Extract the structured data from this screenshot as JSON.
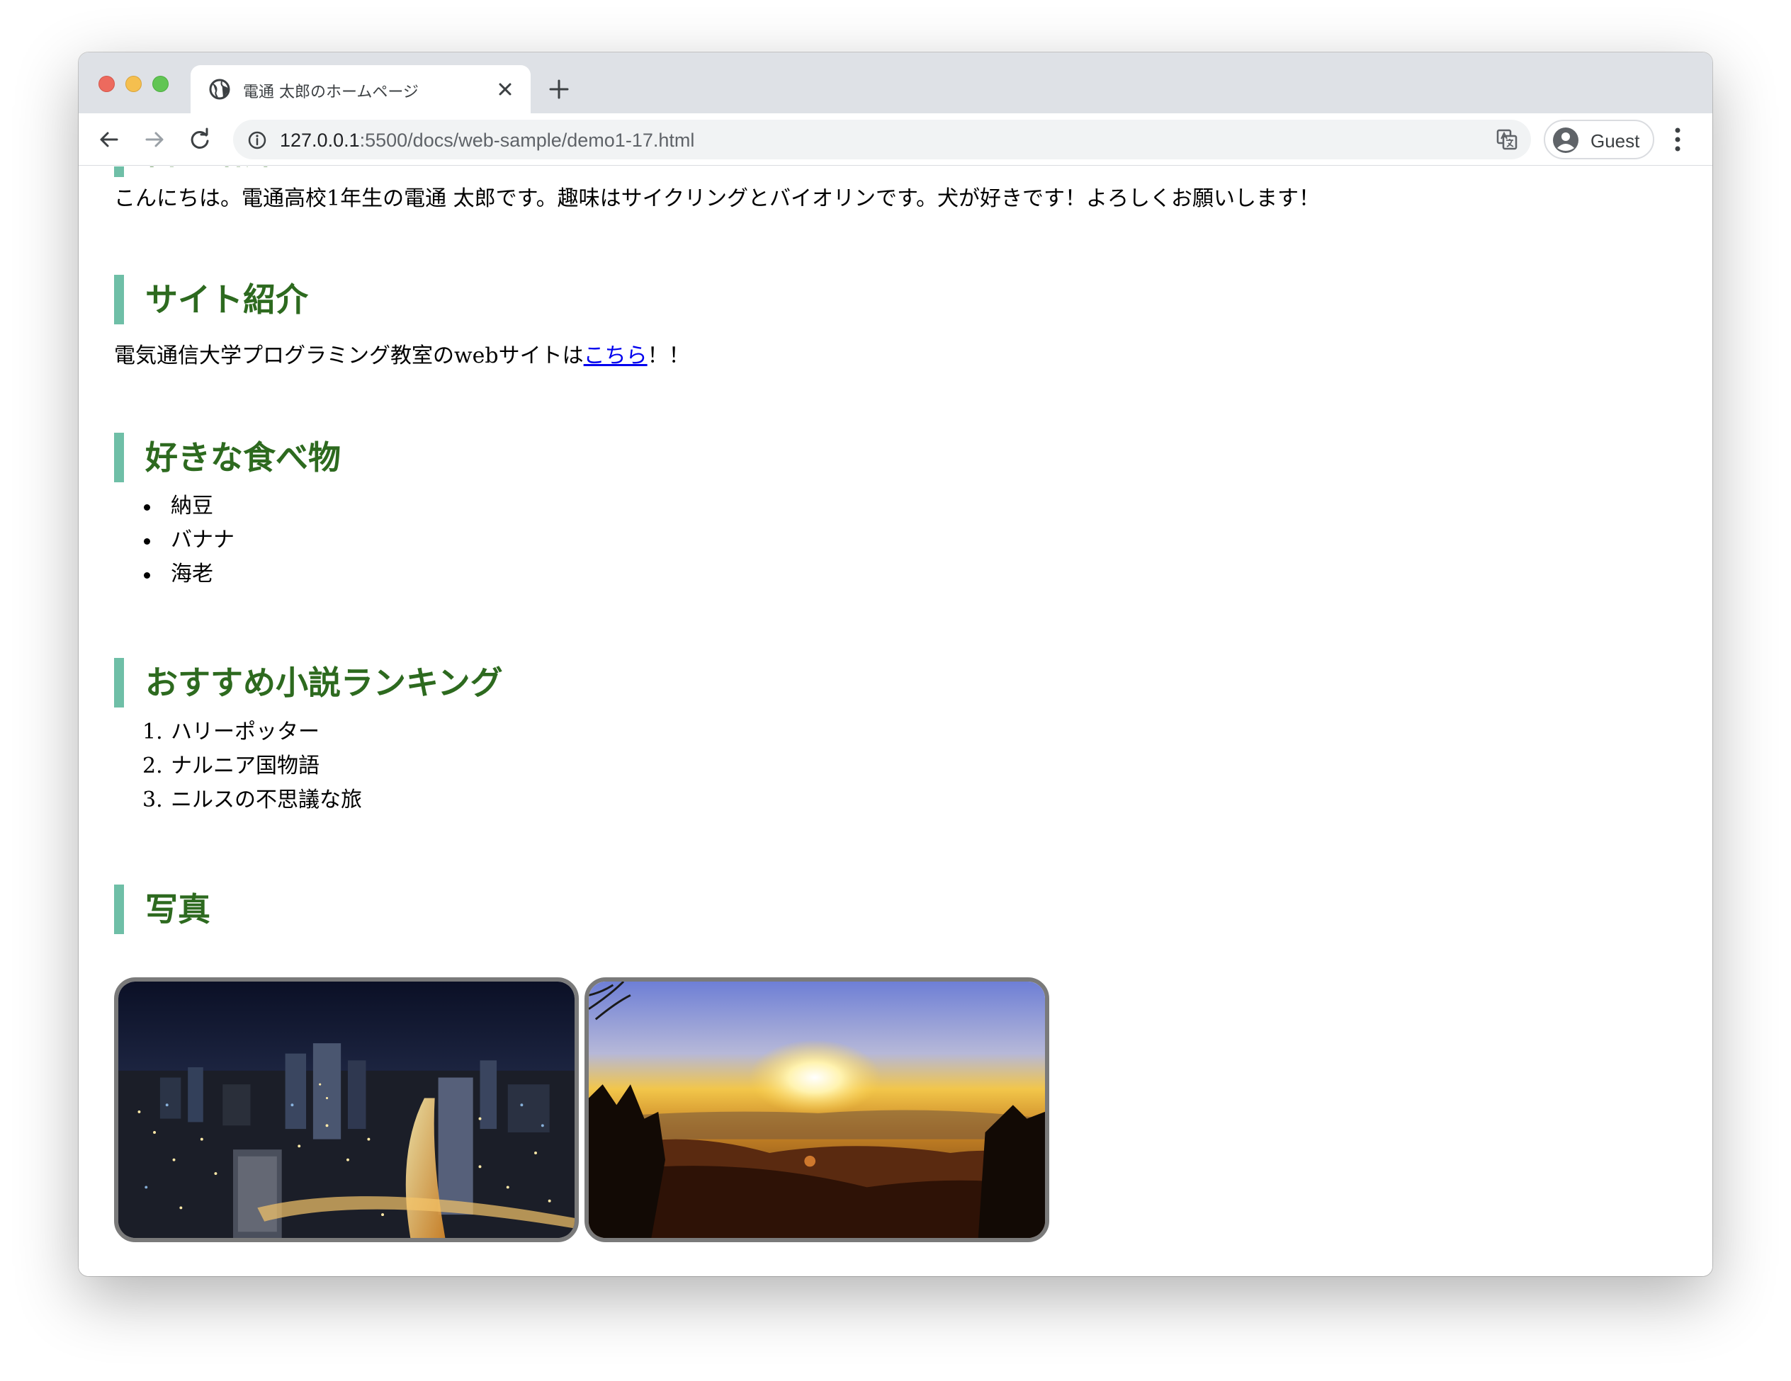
{
  "browser": {
    "tab_title": "電通 太郎のホームページ",
    "url_host": "127.0.0.1",
    "url_rest": ":5500/docs/web-sample/demo1-17.html",
    "profile_label": "Guest",
    "icons": [
      "globe-icon",
      "close-icon",
      "plus-icon",
      "back-arrow-icon",
      "forward-arrow-icon",
      "reload-icon",
      "info-icon",
      "translate-icon",
      "person-avatar-icon",
      "kebab-menu-icon"
    ]
  },
  "page": {
    "intro_heading_partial": "自己紹介",
    "intro_text": "こんにちは。電通高校1年生の電通 太郎です。趣味はサイクリングとバイオリンです。犬が好きです！よろしくお願いします！",
    "site_heading": "サイト紹介",
    "site_text_before": "電気通信大学プログラミング教室のwebサイトは",
    "site_link": "こちら",
    "site_text_after": "！！",
    "food_heading": "好きな食べ物",
    "foods": [
      "納豆",
      "バナナ",
      "海老"
    ],
    "novel_heading": "おすすめ小説ランキング",
    "novels": [
      "ハリーポッター",
      "ナルニア国物語",
      "ニルスの不思議な旅"
    ],
    "photo_heading": "写真",
    "photos": [
      "city-night-photo",
      "sunrise-photo"
    ]
  },
  "colors": {
    "heading_text": "#2d6a1f",
    "heading_bar": "#6fbfa7",
    "link": "#0000ee",
    "photo_border": "#7a7a7a"
  }
}
